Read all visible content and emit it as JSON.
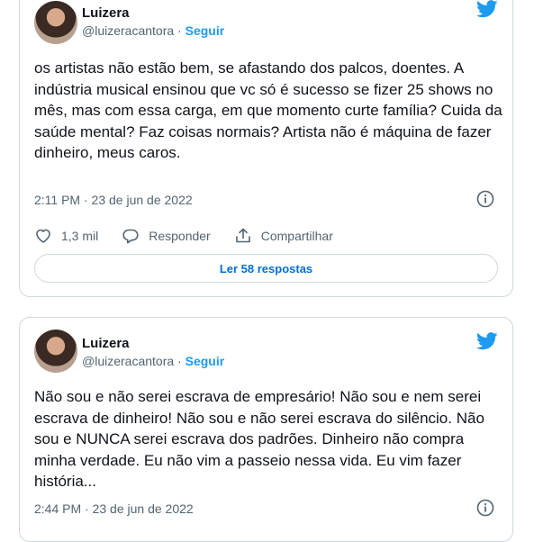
{
  "tweets": [
    {
      "author_name": "Luizera",
      "author_handle": "@luizeracantora",
      "separator": " · ",
      "follow_label": "Seguir",
      "text": "os artistas não estão bem, se afastando dos palcos, doentes. A indústria musical ensinou que vc só é sucesso se fizer 25 shows no mês, mas com essa carga, em que momento curte família? Cuida da saúde mental? Faz coisas normais? Artista não é máquina de fazer dinheiro, meus caros.",
      "timestamp": "2:11 PM · 23 de jun de 2022",
      "like_count": "1,3 mil",
      "reply_label": "Responder",
      "share_label": "Compartilhar",
      "read_replies_label": "Ler 58 respostas"
    },
    {
      "author_name": "Luizera",
      "author_handle": "@luizeracantora",
      "separator": " · ",
      "follow_label": "Seguir",
      "text": "Não sou e não serei escrava de empresário! Não sou e nem serei escrava de dinheiro! Não sou e não serei escrava do silêncio. Não sou e NUNCA serei escrava dos padrões. Dinheiro não compra minha verdade. Eu não vim a passeio nessa vida. Eu vim fazer história...",
      "timestamp": "2:44 PM · 23 de jun de 2022"
    }
  ],
  "colors": {
    "accent": "#1d9bf0",
    "secondary_text": "#536471",
    "border": "#cfd9de"
  },
  "icons": [
    "twitter-bird-icon",
    "info-icon",
    "heart-icon",
    "reply-icon",
    "share-icon"
  ]
}
